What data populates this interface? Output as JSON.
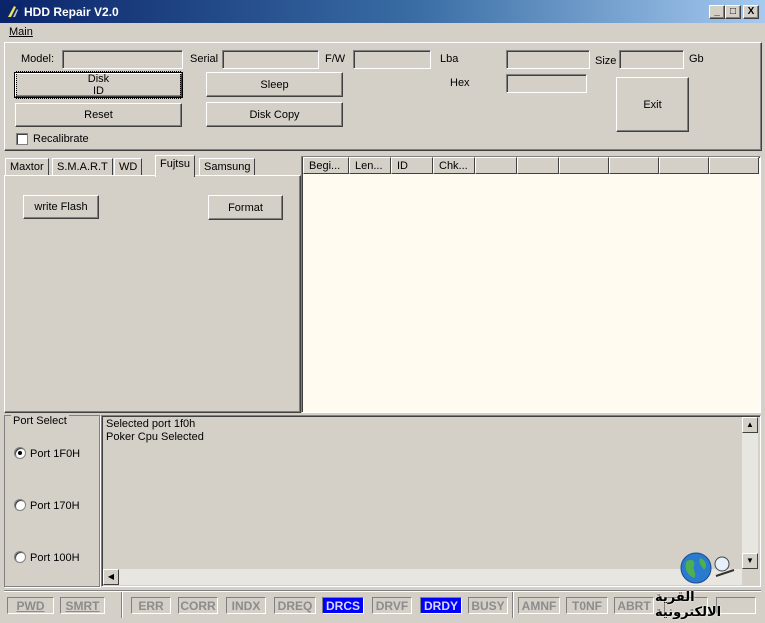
{
  "window": {
    "title": "HDD Repair V2.0",
    "minimize": "_",
    "maximize": "□",
    "close": "X"
  },
  "menu": {
    "main": "Main"
  },
  "info": {
    "model_label": "Model:",
    "serial_label": "Serial",
    "fw_label": "F/W",
    "lba_label": "Lba",
    "size_label": "Size",
    "gb_label": "Gb",
    "hex_label": "Hex",
    "model_value": "",
    "serial_value": "",
    "fw_value": "",
    "lba_value": "",
    "size_value": "",
    "hex_value": ""
  },
  "buttons": {
    "disk_id": "Disk ID",
    "reset": "Reset",
    "sleep": "Sleep",
    "disk_copy": "Disk Copy",
    "exit": "Exit",
    "write_flash": "write Flash",
    "format": "Format"
  },
  "recalibrate": {
    "label": "Recalibrate",
    "checked": false
  },
  "tabs": [
    {
      "label": "Maxtor"
    },
    {
      "label": "S.M.A.R.T"
    },
    {
      "label": "WD"
    },
    {
      "label": "Fujtsu",
      "active": true
    },
    {
      "label": "Samsung"
    }
  ],
  "table": {
    "columns": [
      "Begi...",
      "Len...",
      "ID",
      "Chk...",
      "",
      "",
      "",
      "",
      "",
      ""
    ]
  },
  "port_select": {
    "title": "Port Select",
    "options": [
      {
        "label": "Port 1F0H",
        "selected": true
      },
      {
        "label": "Port 170H",
        "selected": false
      },
      {
        "label": "Port 100H",
        "selected": false
      }
    ]
  },
  "log": {
    "lines": [
      "Selected port 1f0h",
      "Poker Cpu Selected"
    ]
  },
  "status": {
    "pwd": "PWD",
    "smrt": "SMRT",
    "flags": [
      {
        "label": "ERR",
        "on": false
      },
      {
        "label": "CORR",
        "on": false
      },
      {
        "label": "INDX",
        "on": false
      },
      {
        "label": "DREQ",
        "on": false
      },
      {
        "label": "DRCS",
        "on": true
      },
      {
        "label": "DRVF",
        "on": false
      },
      {
        "label": "DRDY",
        "on": true
      },
      {
        "label": "BUSY",
        "on": false
      },
      {
        "label": "AMNF",
        "on": false
      },
      {
        "label": "T0NF",
        "on": false
      },
      {
        "label": "ABRT",
        "on": false
      }
    ]
  },
  "watermark": {
    "text": "القرية الالكترونية"
  },
  "colors": {
    "face": "#d4d0c8",
    "list_bg": "#fffbf0",
    "indicator_on": "#0000ff"
  }
}
